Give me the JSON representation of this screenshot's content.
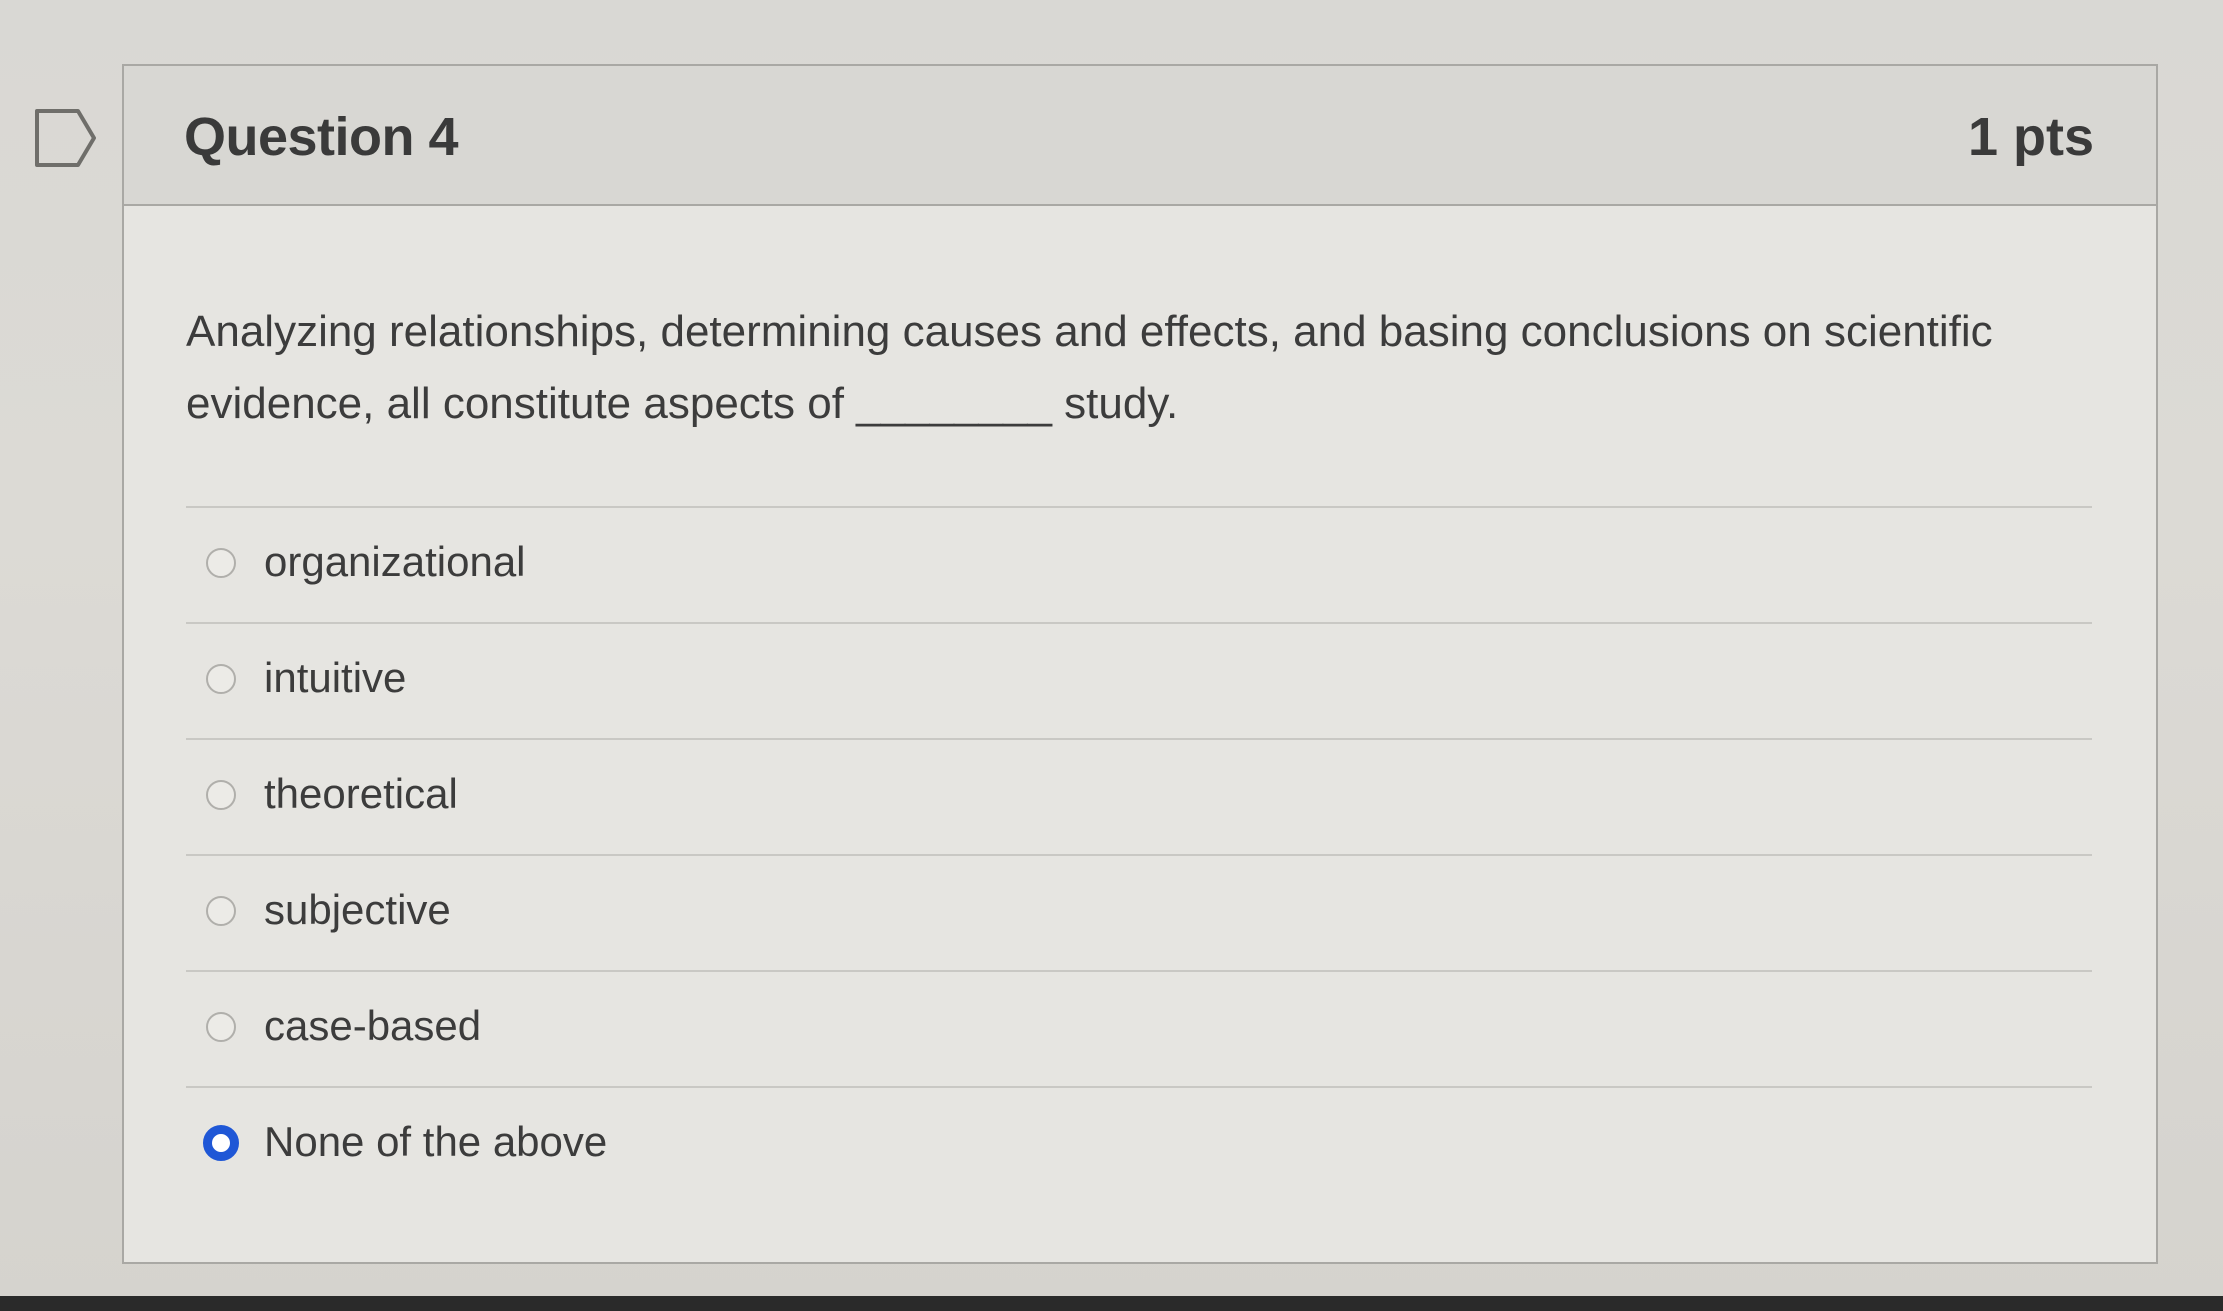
{
  "question": {
    "title": "Question 4",
    "points": "1 pts",
    "text": "Analyzing relationships, determining causes and effects, and basing conclusions on scientific evidence, all constitute aspects of ________ study.",
    "answers": [
      {
        "label": "organizational",
        "selected": false
      },
      {
        "label": "intuitive",
        "selected": false
      },
      {
        "label": "theoretical",
        "selected": false
      },
      {
        "label": "subjective",
        "selected": false
      },
      {
        "label": "case-based",
        "selected": false
      },
      {
        "label": "None of the above",
        "selected": true
      }
    ]
  },
  "icons": {
    "bookmark": "bookmark-flag-icon"
  },
  "colors": {
    "selected_radio": "#1f57d6",
    "header_bg": "#d8d7d3",
    "body_bg": "#e6e5e1"
  }
}
